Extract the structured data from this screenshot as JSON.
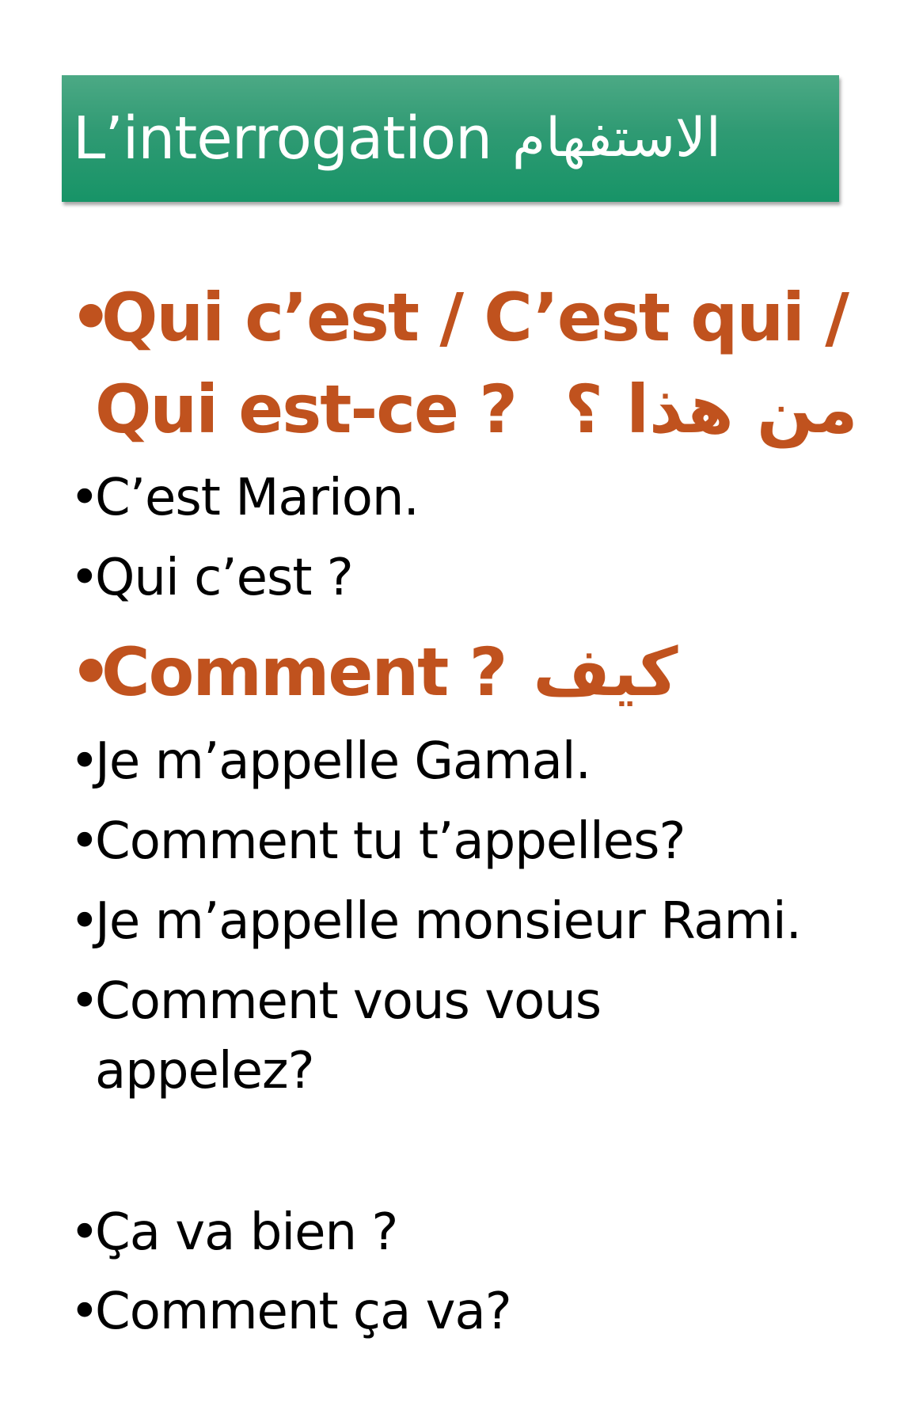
{
  "title": {
    "text": "L’interrogation",
    "arabic": "الاستفهام"
  },
  "bullet": "•",
  "sections": {
    "qui": {
      "line1": "Qui c’est / C’est qui /",
      "line2": "Qui est-ce ?",
      "arabic": "من هذا ؟"
    },
    "qui_examples": [
      "C’est Marion.",
      "Qui c’est ?"
    ],
    "comment": {
      "text": "Comment ?",
      "arabic": "كيف"
    },
    "comment_examples": [
      "Je m’appelle Gamal.",
      "Comment tu t’appelles?",
      "Je m’appelle monsieur Rami.",
      "Comment vous vous",
      "appelez?"
    ],
    "ca_va": [
      "Ça va bien ?",
      "Comment ça va?"
    ]
  },
  "colors": {
    "title_bg": "#2f9a73",
    "heading": "#c0521e",
    "body_text": "#000000"
  }
}
